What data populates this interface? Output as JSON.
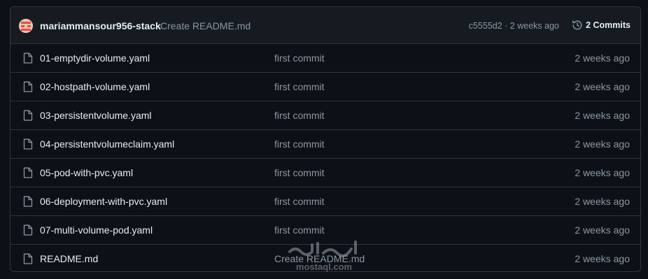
{
  "header": {
    "author": "mariammansour956-stack",
    "commit_message": "Create README.md",
    "hash_time": "c5555d2 · 2 weeks ago",
    "commits_label": "2 Commits"
  },
  "files": [
    {
      "name": "01-emptydir-volume.yaml",
      "message": "first commit",
      "time": "2 weeks ago"
    },
    {
      "name": "02-hostpath-volume.yaml",
      "message": "first commit",
      "time": "2 weeks ago"
    },
    {
      "name": "03-persistentvolume.yaml",
      "message": "first commit",
      "time": "2 weeks ago"
    },
    {
      "name": "04-persistentvolumeclaim.yaml",
      "message": "first commit",
      "time": "2 weeks ago"
    },
    {
      "name": "05-pod-with-pvc.yaml",
      "message": "first commit",
      "time": "2 weeks ago"
    },
    {
      "name": "06-deployment-with-pvc.yaml",
      "message": "first commit",
      "time": "2 weeks ago"
    },
    {
      "name": "07-multi-volume-pod.yaml",
      "message": "first commit",
      "time": "2 weeks ago"
    },
    {
      "name": "README.md",
      "message": "Create README.md",
      "time": "2 weeks ago"
    }
  ],
  "watermark": {
    "text": "mostaql.com"
  },
  "icons": {
    "file": "file-icon",
    "history": "history-icon",
    "avatar": "avatar"
  },
  "colors": {
    "background": "#0d1117",
    "header_bg": "#161b22",
    "border": "#30363d",
    "text_primary": "#e6edf3",
    "text_muted": "#8d96a0"
  }
}
